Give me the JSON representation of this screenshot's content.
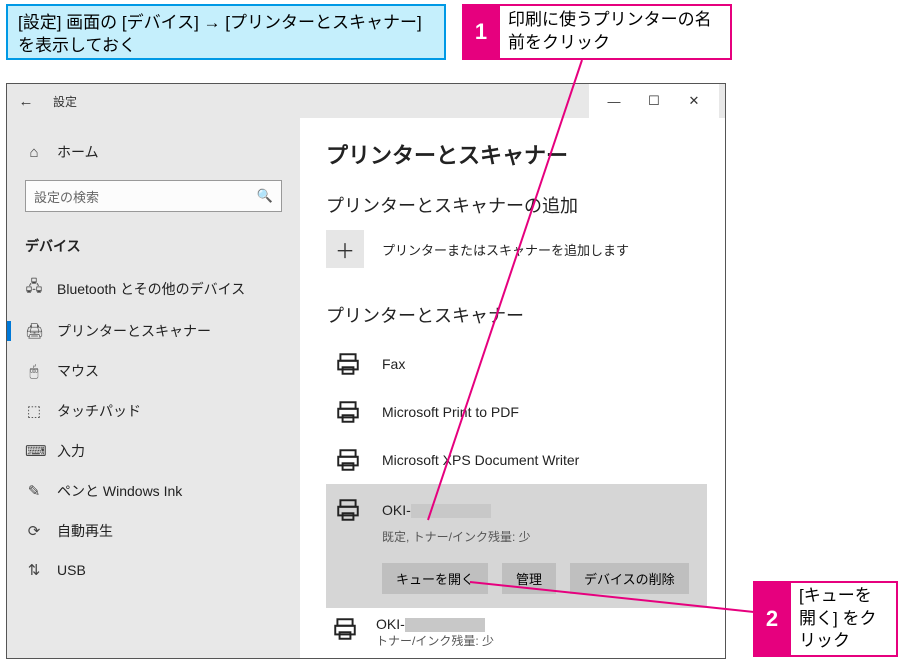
{
  "callouts": {
    "prep": "[設定] 画面の [デバイス] → [プリンターとスキャナー] を表示しておく",
    "step1_num": "1",
    "step1_txt": "印刷に使うプリンターの名前をクリック",
    "step2_num": "2",
    "step2_txt": "[キューを開く] をクリック"
  },
  "window": {
    "title": "設定",
    "back": "←",
    "min": "—",
    "max": "☐",
    "close": "✕"
  },
  "sidebar": {
    "home_icon": "⌂",
    "home": "ホーム",
    "search_placeholder": "設定の検索",
    "search_icon": "🔍",
    "group": "デバイス",
    "items": [
      {
        "icon": "🖧",
        "label": "Bluetooth とその他のデバイス",
        "active": false
      },
      {
        "icon": "🖨",
        "label": "プリンターとスキャナー",
        "active": true
      },
      {
        "icon": "🖱",
        "label": "マウス",
        "active": false
      },
      {
        "icon": "⬚",
        "label": "タッチパッド",
        "active": false
      },
      {
        "icon": "⌨",
        "label": "入力",
        "active": false
      },
      {
        "icon": "✎",
        "label": "ペンと Windows Ink",
        "active": false
      },
      {
        "icon": "⟳",
        "label": "自動再生",
        "active": false
      },
      {
        "icon": "⇅",
        "label": "USB",
        "active": false
      }
    ]
  },
  "main": {
    "h1": "プリンターとスキャナー",
    "add_h2": "プリンターとスキャナーの追加",
    "add_plus": "＋",
    "add_label": "プリンターまたはスキャナーを追加します",
    "list_h2": "プリンターとスキャナー",
    "printers": {
      "fax": "Fax",
      "pdf": "Microsoft Print to PDF",
      "xps": "Microsoft XPS Document Writer",
      "oki_prefix": "OKI-",
      "oki_status": "既定, トナー/インク残量: 少",
      "last_status": "トナー/インク残量: 少"
    },
    "buttons": {
      "queue": "キューを開く",
      "manage": "管理",
      "remove": "デバイスの削除"
    }
  }
}
